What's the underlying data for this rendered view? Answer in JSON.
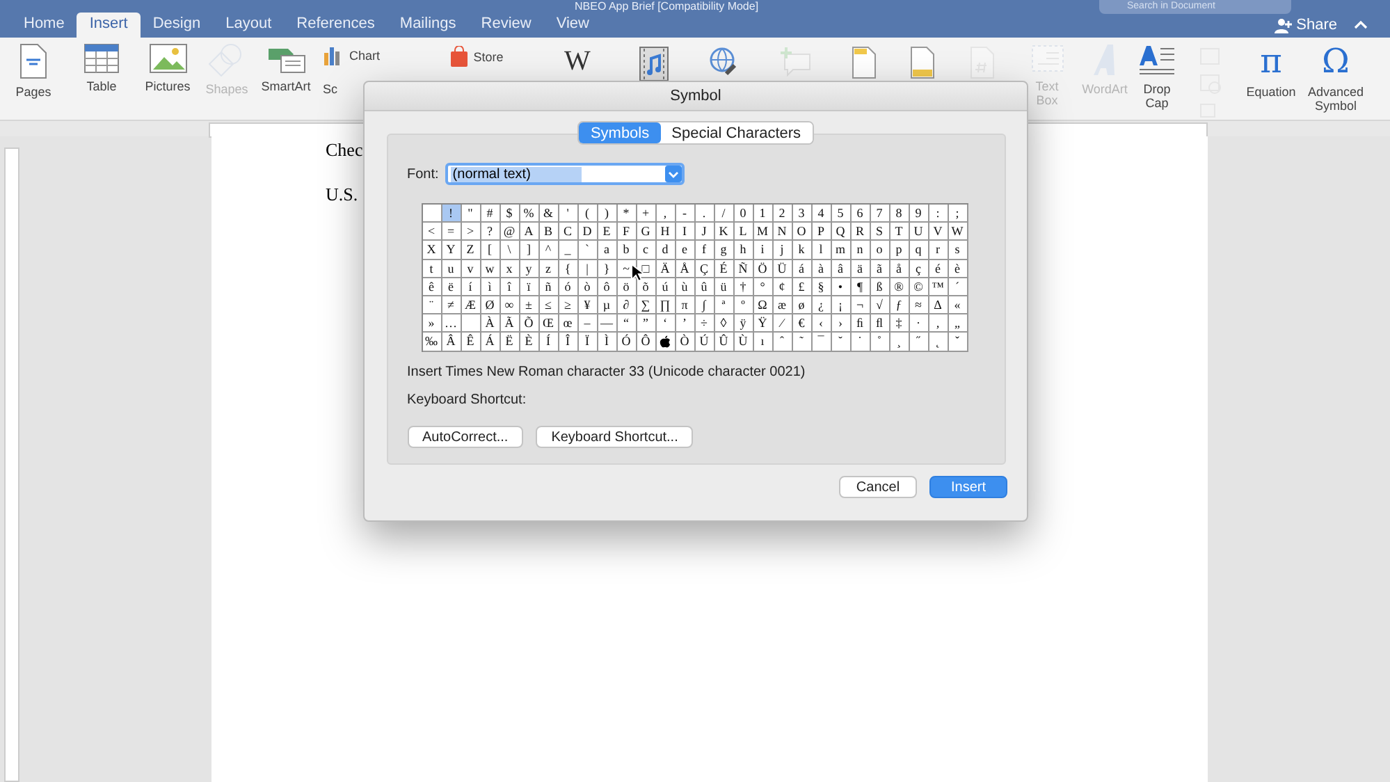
{
  "window": {
    "title": "NBEO App Brief [Compatibility Mode]",
    "search": {
      "placeholder": "Search in Document"
    }
  },
  "tabs": [
    {
      "label": "Home",
      "selected": false
    },
    {
      "label": "Insert",
      "selected": true
    },
    {
      "label": "Design",
      "selected": false
    },
    {
      "label": "Layout",
      "selected": false
    },
    {
      "label": "References",
      "selected": false
    },
    {
      "label": "Mailings",
      "selected": false
    },
    {
      "label": "Review",
      "selected": false
    },
    {
      "label": "View",
      "selected": false
    }
  ],
  "share": {
    "label": "Share"
  },
  "ribbon": [
    {
      "kind": "pages",
      "label": "Pages",
      "disabled": false
    },
    {
      "kind": "table",
      "label": "Table",
      "disabled": false
    },
    {
      "kind": "pictures",
      "label": "Pictures",
      "disabled": false
    },
    {
      "kind": "shapes",
      "label": "Shapes",
      "disabled": true
    },
    {
      "kind": "smartart",
      "label": "SmartArt",
      "disabled": false
    },
    {
      "kind": "chart",
      "label": "Chart",
      "second": "Sc",
      "disabled": false
    },
    {
      "kind": "store",
      "label": "Store",
      "disabled": false
    },
    {
      "kind": "wiki",
      "glyph": "W",
      "disabled": false
    },
    {
      "kind": "media",
      "disabled": false
    },
    {
      "kind": "link",
      "disabled": false
    },
    {
      "kind": "comment",
      "disabled": true
    },
    {
      "kind": "header",
      "disabled": false
    },
    {
      "kind": "footer",
      "disabled": false
    },
    {
      "kind": "pagenum",
      "disabled": true
    },
    {
      "kind": "textbox",
      "label": "Text Box",
      "disabled": true
    },
    {
      "kind": "wordart",
      "label": "WordArt",
      "disabled": true
    },
    {
      "kind": "dropcap",
      "label": "Drop Cap",
      "disabled": false
    },
    {
      "kind": "misc",
      "disabled": true
    },
    {
      "kind": "equation",
      "glyph": "π",
      "label": "Equation",
      "disabled": false
    },
    {
      "kind": "symbol",
      "glyph": "Ω",
      "label": "Advanced Symbol",
      "disabled": false
    }
  ],
  "document": {
    "lines": [
      "Chec",
      "U.S."
    ]
  },
  "dialog": {
    "title": "Symbol",
    "tabs": [
      {
        "label": "Symbols",
        "selected": true
      },
      {
        "label": "Special Characters",
        "selected": false
      }
    ],
    "font": {
      "label": "Font:",
      "value": "(normal text)"
    },
    "grid": [
      [
        {
          "selected": false
        },
        {
          "c": "!",
          "selected": true
        },
        {
          "c": "\"",
          "selected": false
        },
        {
          "c": "#",
          "selected": false
        },
        {
          "c": "$",
          "selected": false
        },
        {
          "c": "%",
          "selected": false
        },
        {
          "c": "&",
          "selected": false
        },
        {
          "c": "'",
          "selected": false
        },
        {
          "c": "(",
          "selected": false
        },
        {
          "c": ")",
          "selected": false
        },
        {
          "c": "*",
          "selected": false
        },
        {
          "c": "+",
          "selected": false
        },
        {
          "c": ",",
          "selected": false
        },
        {
          "c": "-",
          "selected": false
        },
        {
          "c": ".",
          "selected": false
        },
        {
          "c": "/",
          "selected": false
        },
        {
          "c": "0",
          "selected": false
        },
        {
          "c": "1",
          "selected": false
        },
        {
          "c": "2",
          "selected": false
        },
        {
          "c": "3",
          "selected": false
        },
        {
          "c": "4",
          "selected": false
        },
        {
          "c": "5",
          "selected": false
        },
        {
          "c": "6",
          "selected": false
        },
        {
          "c": "7",
          "selected": false
        },
        {
          "c": "8",
          "selected": false
        },
        {
          "c": "9",
          "selected": false
        },
        {
          "c": ":",
          "selected": false
        },
        {
          "c": ";",
          "selected": false
        }
      ],
      [
        {
          "c": "<",
          "selected": false
        },
        {
          "c": "=",
          "selected": false
        },
        {
          "c": ">",
          "selected": false
        },
        {
          "c": "?",
          "selected": false
        },
        {
          "c": "@",
          "selected": false
        },
        {
          "c": "A",
          "selected": false
        },
        {
          "c": "B",
          "selected": false
        },
        {
          "c": "C",
          "selected": false
        },
        {
          "c": "D",
          "selected": false
        },
        {
          "c": "E",
          "selected": false
        },
        {
          "c": "F",
          "selected": false
        },
        {
          "c": "G",
          "selected": false
        },
        {
          "c": "H",
          "selected": false
        },
        {
          "c": "I",
          "selected": false
        },
        {
          "c": "J",
          "selected": false
        },
        {
          "c": "K",
          "selected": false
        },
        {
          "c": "L",
          "selected": false
        },
        {
          "c": "M",
          "selected": false
        },
        {
          "c": "N",
          "selected": false
        },
        {
          "c": "O",
          "selected": false
        },
        {
          "c": "P",
          "selected": false
        },
        {
          "c": "Q",
          "selected": false
        },
        {
          "c": "R",
          "selected": false
        },
        {
          "c": "S",
          "selected": false
        },
        {
          "c": "T",
          "selected": false
        },
        {
          "c": "U",
          "selected": false
        },
        {
          "c": "V",
          "selected": false
        },
        {
          "c": "W",
          "selected": false
        }
      ],
      [
        {
          "c": "X",
          "selected": false
        },
        {
          "c": "Y",
          "selected": false
        },
        {
          "c": "Z",
          "selected": false
        },
        {
          "c": "[",
          "selected": false
        },
        {
          "c": "\\",
          "selected": false
        },
        {
          "c": "]",
          "selected": false
        },
        {
          "c": "^",
          "selected": false
        },
        {
          "c": "_",
          "selected": false
        },
        {
          "c": "`",
          "selected": false
        },
        {
          "c": "a",
          "selected": false
        },
        {
          "c": "b",
          "selected": false
        },
        {
          "c": "c",
          "selected": false
        },
        {
          "c": "d",
          "selected": false
        },
        {
          "c": "e",
          "selected": false
        },
        {
          "c": "f",
          "selected": false
        },
        {
          "c": "g",
          "selected": false
        },
        {
          "c": "h",
          "selected": false
        },
        {
          "c": "i",
          "selected": false
        },
        {
          "c": "j",
          "selected": false
        },
        {
          "c": "k",
          "selected": false
        },
        {
          "c": "l",
          "selected": false
        },
        {
          "c": "m",
          "selected": false
        },
        {
          "c": "n",
          "selected": false
        },
        {
          "c": "o",
          "selected": false
        },
        {
          "c": "p",
          "selected": false
        },
        {
          "c": "q",
          "selected": false
        },
        {
          "c": "r",
          "selected": false
        },
        {
          "c": "s",
          "selected": false
        }
      ],
      [
        {
          "c": "t",
          "selected": false
        },
        {
          "c": "u",
          "selected": false
        },
        {
          "c": "v",
          "selected": false
        },
        {
          "c": "w",
          "selected": false
        },
        {
          "c": "x",
          "selected": false
        },
        {
          "c": "y",
          "selected": false
        },
        {
          "c": "z",
          "selected": false
        },
        {
          "c": "{",
          "selected": false
        },
        {
          "c": "|",
          "selected": false
        },
        {
          "c": "}",
          "selected": false
        },
        {
          "c": "~",
          "selected": false
        },
        {
          "c": "□",
          "selected": false
        },
        {
          "c": "Ä",
          "selected": false
        },
        {
          "c": "Å",
          "selected": false
        },
        {
          "c": "Ç",
          "selected": false
        },
        {
          "c": "É",
          "selected": false
        },
        {
          "c": "Ñ",
          "selected": false
        },
        {
          "c": "Ö",
          "selected": false
        },
        {
          "c": "Ü",
          "selected": false
        },
        {
          "c": "á",
          "selected": false
        },
        {
          "c": "à",
          "selected": false
        },
        {
          "c": "â",
          "selected": false
        },
        {
          "c": "ä",
          "selected": false
        },
        {
          "c": "ã",
          "selected": false
        },
        {
          "c": "å",
          "selected": false
        },
        {
          "c": "ç",
          "selected": false
        },
        {
          "c": "é",
          "selected": false
        },
        {
          "c": "è",
          "selected": false
        }
      ],
      [
        {
          "c": "ê",
          "selected": false
        },
        {
          "c": "ë",
          "selected": false
        },
        {
          "c": "í",
          "selected": false
        },
        {
          "c": "ì",
          "selected": false
        },
        {
          "c": "î",
          "selected": false
        },
        {
          "c": "ï",
          "selected": false
        },
        {
          "c": "ñ",
          "selected": false
        },
        {
          "c": "ó",
          "selected": false
        },
        {
          "c": "ò",
          "selected": false
        },
        {
          "c": "ô",
          "selected": false
        },
        {
          "c": "ö",
          "selected": false
        },
        {
          "c": "õ",
          "selected": false
        },
        {
          "c": "ú",
          "selected": false
        },
        {
          "c": "ù",
          "selected": false
        },
        {
          "c": "û",
          "selected": false
        },
        {
          "c": "ü",
          "selected": false
        },
        {
          "c": "†",
          "selected": false
        },
        {
          "c": "°",
          "selected": false
        },
        {
          "c": "¢",
          "selected": false
        },
        {
          "c": "£",
          "selected": false
        },
        {
          "c": "§",
          "selected": false
        },
        {
          "c": "•",
          "selected": false
        },
        {
          "c": "¶",
          "selected": false
        },
        {
          "c": "ß",
          "selected": false
        },
        {
          "c": "®",
          "selected": false
        },
        {
          "c": "©",
          "selected": false
        },
        {
          "c": "™",
          "selected": false
        },
        {
          "c": "´",
          "selected": false
        }
      ],
      [
        {
          "c": "¨",
          "selected": false
        },
        {
          "c": "≠",
          "selected": false
        },
        {
          "c": "Æ",
          "selected": false
        },
        {
          "c": "Ø",
          "selected": false
        },
        {
          "c": "∞",
          "selected": false
        },
        {
          "c": "±",
          "selected": false
        },
        {
          "c": "≤",
          "selected": false
        },
        {
          "c": "≥",
          "selected": false
        },
        {
          "c": "¥",
          "selected": false
        },
        {
          "c": "µ",
          "selected": false
        },
        {
          "c": "∂",
          "selected": false
        },
        {
          "c": "∑",
          "selected": false
        },
        {
          "c": "∏",
          "selected": false
        },
        {
          "c": "π",
          "selected": false
        },
        {
          "c": "∫",
          "selected": false
        },
        {
          "c": "ª",
          "selected": false
        },
        {
          "c": "º",
          "selected": false
        },
        {
          "c": "Ω",
          "selected": false
        },
        {
          "c": "æ",
          "selected": false
        },
        {
          "c": "ø",
          "selected": false
        },
        {
          "c": "¿",
          "selected": false
        },
        {
          "c": "¡",
          "selected": false
        },
        {
          "c": "¬",
          "selected": false
        },
        {
          "c": "√",
          "selected": false
        },
        {
          "c": "ƒ",
          "selected": false
        },
        {
          "c": "≈",
          "selected": false
        },
        {
          "c": "∆",
          "selected": false
        },
        {
          "c": "«",
          "selected": false
        }
      ],
      [
        {
          "c": "»",
          "selected": false
        },
        {
          "c": "…",
          "selected": false
        },
        {
          "selected": false
        },
        {
          "c": "À",
          "selected": false
        },
        {
          "c": "Ã",
          "selected": false
        },
        {
          "c": "Õ",
          "selected": false
        },
        {
          "c": "Œ",
          "selected": false
        },
        {
          "c": "œ",
          "selected": false
        },
        {
          "c": "–",
          "selected": false
        },
        {
          "c": "—",
          "selected": false
        },
        {
          "c": "“",
          "selected": false
        },
        {
          "c": "”",
          "selected": false
        },
        {
          "c": "‘",
          "selected": false
        },
        {
          "c": "’",
          "selected": false
        },
        {
          "c": "÷",
          "selected": false
        },
        {
          "c": "◊",
          "selected": false
        },
        {
          "c": "ÿ",
          "selected": false
        },
        {
          "c": "Ÿ",
          "selected": false
        },
        {
          "c": "⁄",
          "selected": false
        },
        {
          "c": "€",
          "selected": false
        },
        {
          "c": "‹",
          "selected": false
        },
        {
          "c": "›",
          "selected": false
        },
        {
          "c": "ﬁ",
          "selected": false
        },
        {
          "c": "ﬂ",
          "selected": false
        },
        {
          "c": "‡",
          "selected": false
        },
        {
          "c": "·",
          "selected": false
        },
        {
          "c": "‚",
          "selected": false
        },
        {
          "c": "„",
          "selected": false
        }
      ],
      [
        {
          "c": "‰",
          "selected": false
        },
        {
          "c": "Â",
          "selected": false
        },
        {
          "c": "Ê",
          "selected": false
        },
        {
          "c": "Á",
          "selected": false
        },
        {
          "c": "Ë",
          "selected": false
        },
        {
          "c": "È",
          "selected": false
        },
        {
          "c": "Í",
          "selected": false
        },
        {
          "c": "Î",
          "selected": false
        },
        {
          "c": "Ï",
          "selected": false
        },
        {
          "c": "Ì",
          "selected": false
        },
        {
          "c": "Ó",
          "selected": false
        },
        {
          "c": "Ô",
          "selected": false
        },
        {
          "kind": "apple",
          "selected": false
        },
        {
          "c": "Ò",
          "selected": false
        },
        {
          "c": "Ú",
          "selected": false
        },
        {
          "c": "Û",
          "selected": false
        },
        {
          "c": "Ù",
          "selected": false
        },
        {
          "c": "ı",
          "selected": false
        },
        {
          "c": "ˆ",
          "selected": false
        },
        {
          "c": "˜",
          "selected": false
        },
        {
          "c": "¯",
          "selected": false
        },
        {
          "c": "˘",
          "selected": false
        },
        {
          "c": "˙",
          "selected": false
        },
        {
          "c": "˚",
          "selected": false
        },
        {
          "c": "¸",
          "selected": false
        },
        {
          "c": "˝",
          "selected": false
        },
        {
          "c": "˛",
          "selected": false
        },
        {
          "c": "ˇ",
          "selected": false
        }
      ]
    ],
    "description": "Insert Times New Roman character 33  (Unicode character 0021)",
    "shortcut_label": "Keyboard Shortcut:",
    "buttons": [
      {
        "label": "AutoCorrect..."
      },
      {
        "label": "Keyboard Shortcut..."
      }
    ],
    "footer_buttons": [
      {
        "label": "Cancel",
        "kind": "plain"
      },
      {
        "label": "Insert",
        "kind": "primary"
      }
    ]
  }
}
